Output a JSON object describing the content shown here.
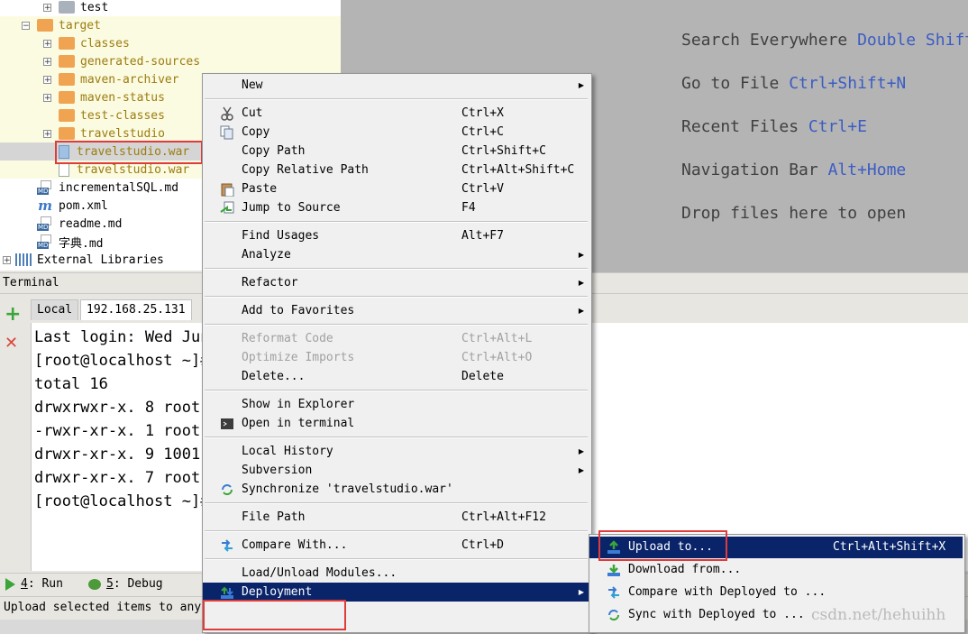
{
  "project_tree": [
    {
      "label": "test",
      "type": "folder-gray",
      "expander": "+",
      "indent": 48
    },
    {
      "label": "target",
      "type": "folder-orange",
      "expander": "−",
      "indent": 24
    },
    {
      "label": "classes",
      "type": "folder-orange",
      "expander": "+",
      "indent": 48
    },
    {
      "label": "generated-sources",
      "type": "folder-orange",
      "expander": "+",
      "indent": 48
    },
    {
      "label": "maven-archiver",
      "type": "folder-orange",
      "expander": "+",
      "indent": 48
    },
    {
      "label": "maven-status",
      "type": "folder-orange",
      "expander": "+",
      "indent": 48
    },
    {
      "label": "test-classes",
      "type": "folder-orange",
      "expander": "",
      "indent": 48
    },
    {
      "label": "travelstudio",
      "type": "folder-orange",
      "expander": "+",
      "indent": 48
    },
    {
      "label": "travelstudio.war",
      "type": "war",
      "expander": "",
      "indent": 48
    },
    {
      "label": "travelstudio.war",
      "type": "file",
      "expander": "",
      "indent": 48
    },
    {
      "label": "incrementalSQL.md",
      "type": "md",
      "expander": "",
      "indent": 24
    },
    {
      "label": "pom.xml",
      "type": "maven",
      "expander": "",
      "indent": 24
    },
    {
      "label": "readme.md",
      "type": "md",
      "expander": "",
      "indent": 24
    },
    {
      "label": "字典.md",
      "type": "md",
      "expander": "",
      "indent": 24
    },
    {
      "label": "External Libraries",
      "type": "lib",
      "expander": "+",
      "indent": 0
    }
  ],
  "md_badge": "MD",
  "maven_glyph": "m",
  "welcome": [
    {
      "text": "Search Everywhere ",
      "key": "Double Shift"
    },
    {
      "text": "Go to File ",
      "key": "Ctrl+Shift+N"
    },
    {
      "text": "Recent Files ",
      "key": "Ctrl+E"
    },
    {
      "text": "Navigation Bar ",
      "key": "Alt+Home"
    },
    {
      "text": "Drop files here to open",
      "key": ""
    }
  ],
  "terminal": {
    "title": "Terminal",
    "tabs": [
      "Local",
      "192.168.25.131"
    ],
    "add_glyph": "+",
    "close_glyph": "✕",
    "lines": [
      "Last login: Wed Jun",
      "[root@localhost ~]#",
      "total 16",
      "drwxrwxr-x. 8 root",
      "-rwxr-xr-x. 1 root",
      "drwxr-xr-x. 9 1001",
      "drwxr-xr-x. 7 root",
      "[root@localhost ~]#"
    ]
  },
  "toolwindows": [
    {
      "num": "4",
      "label": ": Run"
    },
    {
      "num": "5",
      "label": ": Debug"
    }
  ],
  "status_text": "Upload selected items to any",
  "watermark": "csdn.net/hehuihh",
  "context_menu": [
    {
      "label": "New",
      "shortcut": "",
      "submenu": true,
      "icon": ""
    },
    {
      "sep": true
    },
    {
      "label": "Cut",
      "shortcut": "Ctrl+X",
      "icon": "scissors"
    },
    {
      "label": "Copy",
      "shortcut": "Ctrl+C",
      "icon": "copy"
    },
    {
      "label": "Copy Path",
      "shortcut": "Ctrl+Shift+C",
      "icon": ""
    },
    {
      "label": "Copy Relative Path",
      "shortcut": "Ctrl+Alt+Shift+C",
      "icon": ""
    },
    {
      "label": "Paste",
      "shortcut": "Ctrl+V",
      "icon": "paste"
    },
    {
      "label": "Jump to Source",
      "shortcut": "F4",
      "icon": "jump"
    },
    {
      "sep": true
    },
    {
      "label": "Find Usages",
      "shortcut": "Alt+F7",
      "icon": ""
    },
    {
      "label": "Analyze",
      "shortcut": "",
      "submenu": true,
      "icon": ""
    },
    {
      "sep": true
    },
    {
      "label": "Refactor",
      "shortcut": "",
      "submenu": true,
      "icon": ""
    },
    {
      "sep": true
    },
    {
      "label": "Add to Favorites",
      "shortcut": "",
      "submenu": true,
      "icon": ""
    },
    {
      "sep": true
    },
    {
      "label": "Reformat Code",
      "shortcut": "Ctrl+Alt+L",
      "disabled": true,
      "icon": ""
    },
    {
      "label": "Optimize Imports",
      "shortcut": "Ctrl+Alt+O",
      "disabled": true,
      "icon": ""
    },
    {
      "label": "Delete...",
      "shortcut": "Delete",
      "icon": ""
    },
    {
      "sep": true
    },
    {
      "label": "Show in Explorer",
      "shortcut": "",
      "icon": ""
    },
    {
      "label": "Open in terminal",
      "shortcut": "",
      "icon": "terminal"
    },
    {
      "sep": true
    },
    {
      "label": "Local History",
      "shortcut": "",
      "submenu": true,
      "icon": ""
    },
    {
      "label": "Subversion",
      "shortcut": "",
      "submenu": true,
      "icon": ""
    },
    {
      "label": "Synchronize 'travelstudio.war'",
      "shortcut": "",
      "icon": "sync"
    },
    {
      "sep": true
    },
    {
      "label": "File Path",
      "shortcut": "Ctrl+Alt+F12",
      "icon": ""
    },
    {
      "sep": true
    },
    {
      "label": "Compare With...",
      "shortcut": "Ctrl+D",
      "icon": "compare"
    },
    {
      "sep": true
    },
    {
      "label": "Load/Unload Modules...",
      "shortcut": "",
      "icon": ""
    },
    {
      "label": "Deployment",
      "shortcut": "",
      "submenu": true,
      "highlighted": true,
      "icon": "deploy"
    }
  ],
  "submenu": [
    {
      "label": "Upload to...",
      "shortcut": "Ctrl+Alt+Shift+X",
      "highlighted": true,
      "icon": "upload"
    },
    {
      "label": "Download from...",
      "shortcut": "",
      "icon": "download"
    },
    {
      "label": "Compare with Deployed to ...",
      "shortcut": "",
      "icon": "compare"
    },
    {
      "label": "Sync with Deployed to ...",
      "shortcut": "",
      "icon": "sync"
    }
  ],
  "submenu_arrow": "▶",
  "colors": {
    "highlight": "#0a246a",
    "accent_key": "#3b5cc4",
    "redbox": "#e03b3b"
  }
}
